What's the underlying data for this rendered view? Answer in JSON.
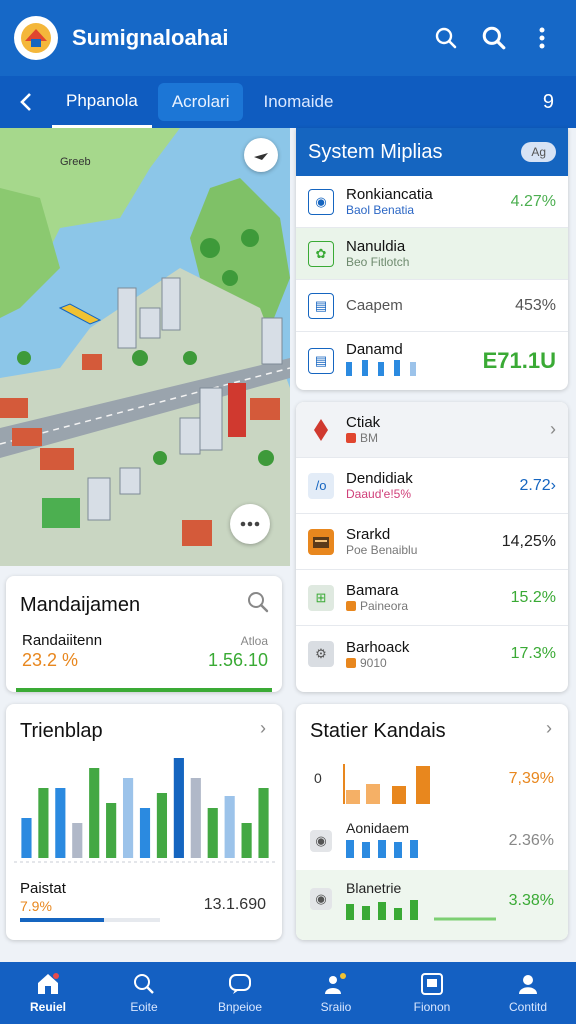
{
  "header": {
    "app_title": "Sumignaloahai",
    "icons": [
      "search-icon",
      "search-icon",
      "more-vert-icon"
    ]
  },
  "tabs": {
    "items": [
      {
        "label": "Phpanola",
        "state": "active"
      },
      {
        "label": "Acrolari",
        "state": "pill"
      },
      {
        "label": "Inomaide",
        "state": "normal"
      }
    ],
    "count": "9"
  },
  "map": {
    "place_label": "Greeb"
  },
  "manda": {
    "title": "Mandaijamen",
    "label": "Randaiitenn",
    "value_left": "23.2 %",
    "small": "Atloa",
    "value_right": "1.56.10",
    "progress": 1.0
  },
  "trend": {
    "title": "Trienblap",
    "bottom_label": "Paistat",
    "bottom_pct": "7.9%",
    "bottom_value": "13.1.690",
    "progress": 0.6
  },
  "system": {
    "title": "System Miplias",
    "badge": "Ag",
    "rows": [
      {
        "name": "Ronkiancatia",
        "sub": "Baol Benatia",
        "value": "4.27%",
        "icon": "globe-icon",
        "color": "#4caf50"
      },
      {
        "name": "Nanuldia",
        "sub": "Beo Fitlotch",
        "value": "",
        "icon": "leaf-icon",
        "color": "#4caf50"
      },
      {
        "name": "Caapem",
        "sub": "",
        "value": "453%",
        "icon": "chart-icon",
        "color": "#555555"
      },
      {
        "name": "Danamd",
        "sub": "",
        "value": "E71.1U",
        "icon": "chart-icon",
        "color": "#3aaa35"
      }
    ]
  },
  "list": {
    "rows": [
      {
        "name": "Ctiak",
        "sub": "BM",
        "value": "",
        "icon": "diamond-icon",
        "color": "#222222",
        "subcolor": "#777777"
      },
      {
        "name": "Dendidiak",
        "sub": "Daaud'e!5%",
        "value": "2.72›",
        "icon": "link-icon",
        "color": "#1565c0",
        "subcolor": "#d0407a"
      },
      {
        "name": "Srarkd",
        "sub": "Poe Benaiblu",
        "value": "14,25%",
        "icon": "folder-icon",
        "color": "#222222",
        "subcolor": "#777777"
      },
      {
        "name": "Bamara",
        "sub": "Paineora",
        "value": "15.2%",
        "icon": "grid-icon",
        "color": "#3aaa35",
        "subcolor": "#777777"
      },
      {
        "name": "Barhoack",
        "sub": "9010",
        "value": "17.3%",
        "icon": "settings-icon",
        "color": "#3aaa35",
        "subcolor": "#777777"
      }
    ]
  },
  "statier": {
    "title": "Statier Kandais",
    "rows": [
      {
        "left": "0",
        "name": "",
        "value": "7,39%",
        "color": "#e8871e"
      },
      {
        "left": "",
        "name": "Aonidaem",
        "value": "2.36%",
        "color": "#888888"
      },
      {
        "left": "",
        "name": "Blanetrie",
        "value": "3.38%",
        "color": "#3aaa35"
      }
    ]
  },
  "chart_data": {
    "type": "bar",
    "values": [
      0.4,
      0.7,
      0.7,
      0.35,
      0.9,
      0.55,
      0.8,
      0.5,
      0.65,
      1.0,
      0.8,
      0.5,
      0.62,
      0.35,
      0.7
    ],
    "colors": [
      "#2b8ae0",
      "#43a843",
      "#2b8ae0",
      "#b0b8c8",
      "#43a843",
      "#43a843",
      "#9cc3ea",
      "#2b8ae0",
      "#43a843",
      "#1565c0",
      "#b0b8c8",
      "#43a843",
      "#9cc3ea",
      "#43a843",
      "#43a843"
    ]
  },
  "nav": {
    "items": [
      {
        "label": "Reuiel",
        "icon": "home-icon",
        "active": true
      },
      {
        "label": "Eoite",
        "icon": "search-icon",
        "active": false
      },
      {
        "label": "Bnpeioe",
        "icon": "chat-icon",
        "active": false
      },
      {
        "label": "Sraiio",
        "icon": "people-icon",
        "active": false
      },
      {
        "label": "Fionon",
        "icon": "image-icon",
        "active": false
      },
      {
        "label": "Contitd",
        "icon": "person-icon",
        "active": false
      }
    ]
  }
}
